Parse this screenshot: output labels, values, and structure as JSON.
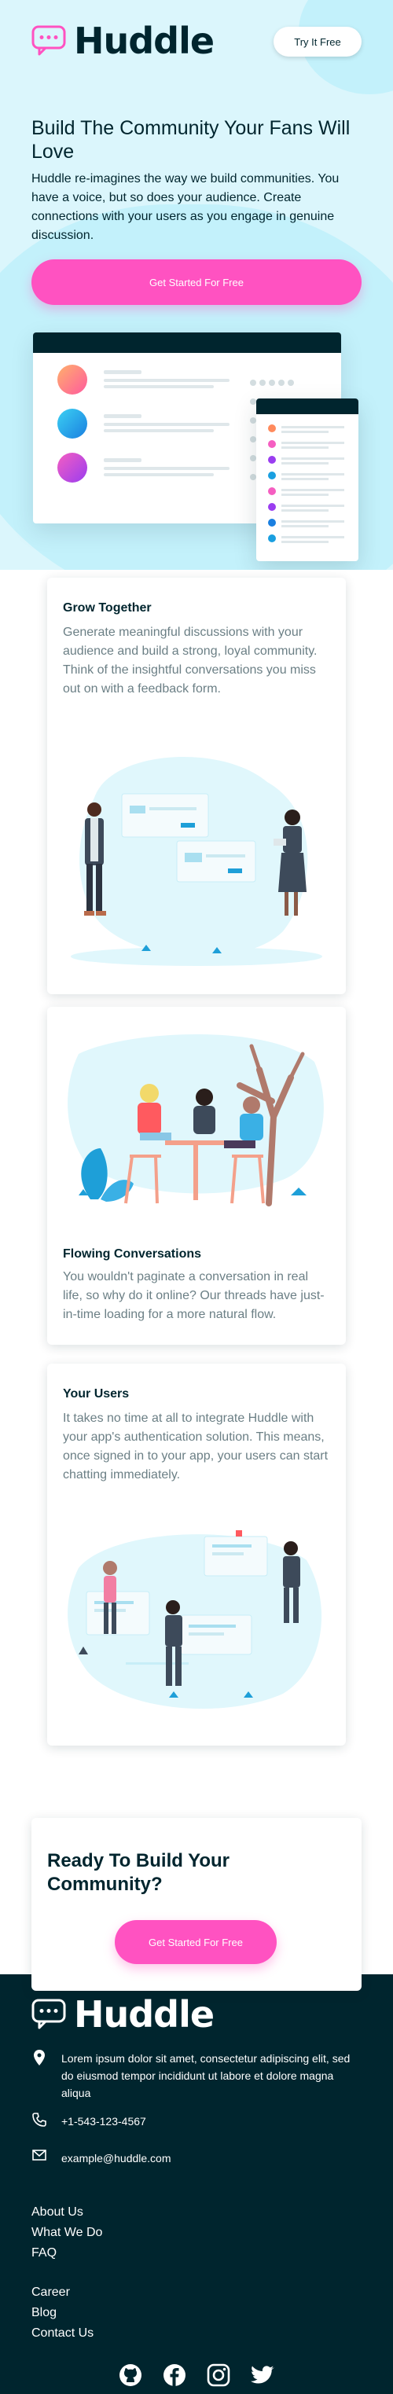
{
  "header": {
    "logo_text": "Huddle",
    "try_button": "Try It Free"
  },
  "hero": {
    "title": "Build The Community Your Fans Will Love",
    "text": "Huddle re-imagines the way we build communities. You have a voice, but so does your audience. Create connections with your users as you engage in genuine discussion.",
    "cta": "Get Started For Free"
  },
  "features": [
    {
      "title": "Grow Together",
      "text": "Generate meaningful discussions with your audience and build a strong, loyal community. Think of the insightful conversations you miss out on with a feedback form."
    },
    {
      "title": "Flowing Conversations",
      "text": "You wouldn't paginate a conversation in real life, so why do it online? Our threads have just-in-time loading for a more natural flow."
    },
    {
      "title": "Your Users",
      "text": "It takes no time at all to integrate Huddle with your app's authentication solution. This means, once signed in to your app, your users can start chatting immediately."
    }
  ],
  "cta_section": {
    "title": "Ready To Build Your Community?",
    "button": "Get Started For Free"
  },
  "footer": {
    "logo_text": "Huddle",
    "address": "Lorem ipsum dolor sit amet, consectetur adipiscing elit, sed do eiusmod tempor incididunt ut labore et dolore magna aliqua",
    "phone": "+1-543-123-4567",
    "email": "example@huddle.com",
    "links_col1": [
      "About Us",
      "What We Do",
      "FAQ"
    ],
    "links_col2": [
      "Career",
      "Blog",
      "Contact Us"
    ],
    "socials": [
      "github-icon",
      "facebook-icon",
      "instagram-icon",
      "twitter-icon"
    ]
  },
  "colors": {
    "brand_dark": "#00252e",
    "accent_pink": "#ff52c1",
    "hero_bg": "#dbf6fc"
  }
}
